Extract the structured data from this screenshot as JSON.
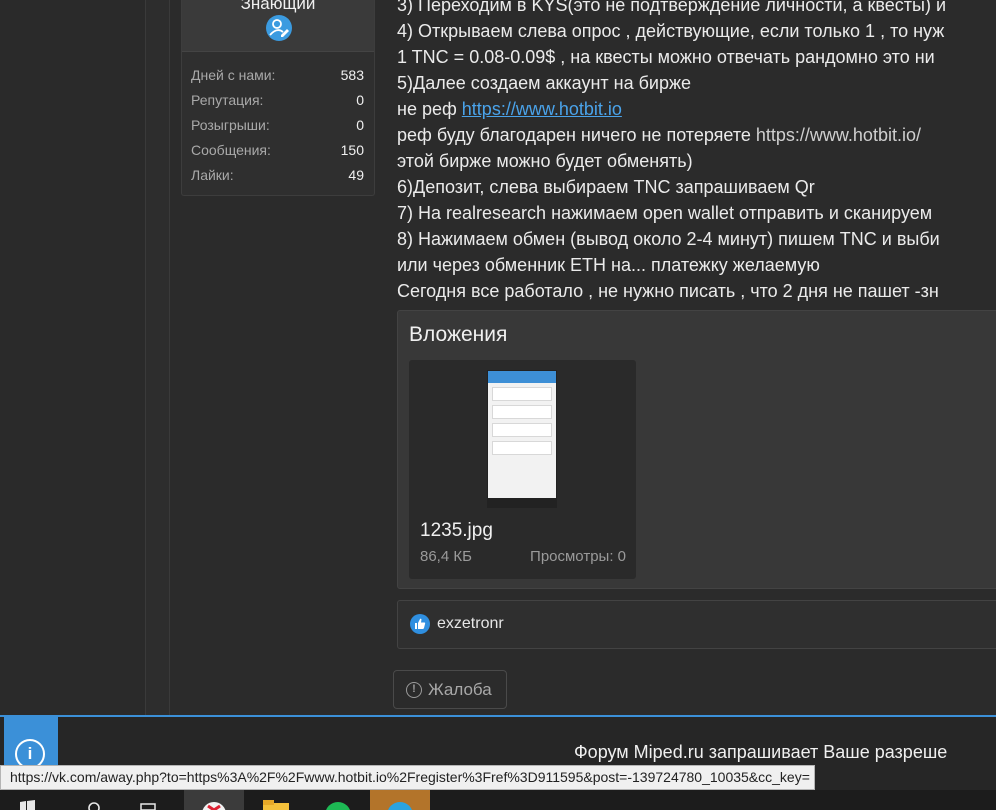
{
  "user_card": {
    "rank": "Знающий",
    "stats": [
      {
        "label": "Дней с нами:",
        "value": "583"
      },
      {
        "label": "Репутация:",
        "value": "0"
      },
      {
        "label": "Розыгрыши:",
        "value": "0"
      },
      {
        "label": "Сообщения:",
        "value": "150"
      },
      {
        "label": "Лайки:",
        "value": "49"
      }
    ]
  },
  "post": {
    "line1": "3) Переходим в KYS(это не подтверждение личности, а квесты) и",
    "line2": "4) Открываем слева опрос , действующие, если только 1 , то нуж",
    "line3": "1 TNC = 0.08-0.09$ , на квесты можно отвечать рандомно это ни",
    "line4": "5)Далее создаем аккаунт на бирже",
    "line5_prefix": "не реф ",
    "line5_link": "https://www.hotbit.io",
    "line6_prefix": "реф буду благодарен ничего не потеряете ",
    "line6_link": "https://www.hotbit.io/",
    "line7": "этой бирже можно будет обменять)",
    "line8": "6)Депозит, слева выбираем TNC запрашиваем Qr",
    "line9": "7) На realresearch нажимаем open wallet отправить и сканируем",
    "line10": "8) Нажимаем обмен (вывод около 2-4 минут) пишем TNC и выби",
    "line11": "или через обменник ETH на... платежку желаемую",
    "line12": "Сегодня все работало , не нужно писать , что 2 дня не пашет -зн"
  },
  "attachments": {
    "title": "Вложения",
    "file": {
      "name": "1235.jpg",
      "size": "86,4 КБ",
      "views": "Просмотры: 0"
    }
  },
  "reactions": {
    "user": "exzetronr"
  },
  "report": {
    "label": "Жалоба"
  },
  "notification": {
    "text": "Форум Miped.ru запрашивает Ваше разреше"
  },
  "status_url": "https://vk.com/away.php?to=https%3A%2F%2Fwww.hotbit.io%2Fregister%3Fref%3D911595&post=-139724780_10035&cc_key=",
  "colors": {
    "accent": "#3b90d8",
    "link": "#4aa3ea",
    "background": "#2b2b2b"
  }
}
